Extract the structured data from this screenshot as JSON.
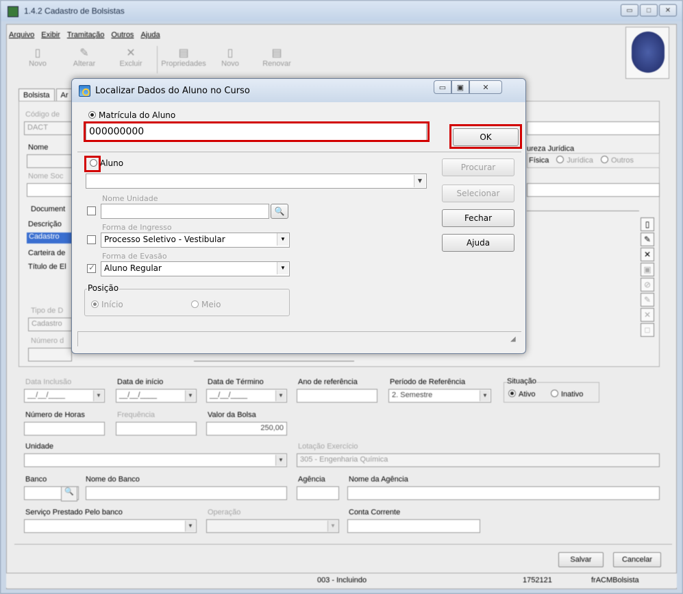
{
  "main": {
    "title": "1.4.2 Cadastro de Bolsistas",
    "menu": [
      "Arquivo",
      "Exibir",
      "Tramitação",
      "Outros",
      "Ajuda"
    ],
    "toolbar": [
      "Novo",
      "Alterar",
      "Excluir",
      "Propriedades",
      "Novo",
      "Renovar"
    ],
    "tabs": [
      "Bolsista",
      "Ar"
    ],
    "fields": {
      "codigo_label": "Código de",
      "codigo_value": "DACT",
      "nome_label": "Nome",
      "nome_social_label": "Nome Soc",
      "documento_label": "Document",
      "descricao_label": "Descrição",
      "doc_items": [
        "Cadastro",
        "Carteira de",
        "Título de El"
      ],
      "tipo_label": "Tipo de D",
      "tipo_value": "Cadastro",
      "numero_label": "Número d",
      "natureza_label": "ureza Jurídica",
      "natureza_fisica": "Física",
      "natureza_juridica": "Jurídica",
      "natureza_outros": "Outros",
      "data_inclusao_label": "Data Inclusão",
      "data_inicio_label": "Data de início",
      "data_termino_label": "Data de Término",
      "ano_referencia_label": "Ano de referência",
      "periodo_label": "Período de Referência",
      "periodo_value": "2. Semestre",
      "situacao_label": "Situação",
      "situacao_ativo": "Ativo",
      "situacao_inativo": "Inativo",
      "date_placeholder": "__/__/____",
      "numero_horas_label": "Número de Horas",
      "frequencia_label": "Frequência",
      "valor_bolsa_label": "Valor da Bolsa",
      "valor_bolsa_value": "250,00",
      "unidade_label": "Unidade",
      "lotacao_label": "Lotação Exercício",
      "lotacao_value": "305 - Engenharia Química",
      "banco_label": "Banco",
      "nome_banco_label": "Nome do Banco",
      "agencia_label": "Agência",
      "nome_agencia_label": "Nome da Agência",
      "servico_label": "Serviço Prestado Pelo banco",
      "operacao_label": "Operação",
      "conta_label": "Conta Corrente"
    },
    "buttons": {
      "salvar": "Salvar",
      "cancelar": "Cancelar"
    },
    "status": {
      "mode": "003 - Incluindo",
      "code": "1752121",
      "form": "frACMBolsista"
    }
  },
  "dialog": {
    "title": "Localizar Dados do Aluno no Curso",
    "matricula_label": "Matrícula do Aluno",
    "matricula_value": "000000000",
    "aluno_label": "Aluno",
    "nome_unidade_label": "Nome Unidade",
    "forma_ingresso_label": "Forma de Ingresso",
    "forma_ingresso_value": "Processo Seletivo - Vestibular",
    "forma_evasao_label": "Forma de Evasão",
    "forma_evasao_value": "Aluno Regular",
    "posicao_label": "Posição",
    "posicao_inicio": "Início",
    "posicao_meio": "Meio",
    "buttons": {
      "ok": "OK",
      "procurar": "Procurar",
      "selecionar": "Selecionar",
      "fechar": "Fechar",
      "ajuda": "Ajuda"
    }
  },
  "colors": {
    "highlight": "#d20000",
    "title_bg": "#cbd9ea"
  },
  "icons": [
    "app-icon",
    "crest-logo",
    "search-icon",
    "minimize-icon",
    "maximize-icon",
    "close-icon",
    "resize-grip-icon"
  ]
}
